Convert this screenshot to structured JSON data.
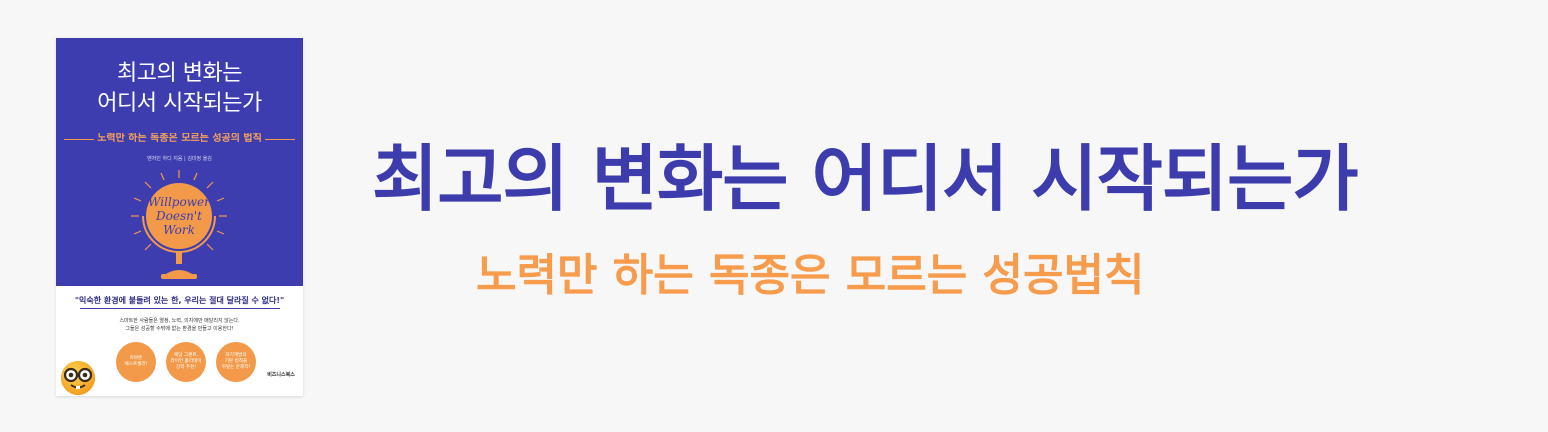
{
  "book": {
    "title_line1": "최고의 변화는",
    "title_line2": "어디서 시작되는가",
    "subtitle": "노력만 하는 독종은 모르는 성공의 법칙",
    "author": "벤저민 하디 지음 | 김미정 옮김",
    "globe_text_1": "Willpower",
    "globe_text_2": "Doesn't",
    "globe_text_3": "Work",
    "quote": "\"익숙한 환경에 붙들려 있는 한, 우리는 절대 달라질 수 없다!\"",
    "blurb_line1": "스마트한 사람들은 열정, 노력, 의지에만 매달리지 않는다.",
    "blurb_line2": "그들은 성공할 수밖에 없는 환경을 만들고 이용한다!",
    "badges": [
      "아마존\n베스트셀러!",
      "애덤 그랜트,\n라이언 홀리데이\n강력 추천!",
      "자기계발의\n기본 법칙을\n뒤엎는 문제작!"
    ],
    "publisher": "비즈니스북스",
    "colors": {
      "cover_blue": "#3d3db0",
      "cover_orange": "#f29a4a"
    }
  },
  "headline": {
    "title": "최고의 변화는 어디서 시작되는가",
    "subtitle": "노력만 하는 독종은 모르는 성공법칙"
  },
  "colors": {
    "title": "#3c3cad",
    "subtitle": "#f79b4c",
    "background": "#f7f7f7"
  },
  "icons": {
    "emoji": "nerd-face-icon",
    "globe": "globe-icon"
  }
}
